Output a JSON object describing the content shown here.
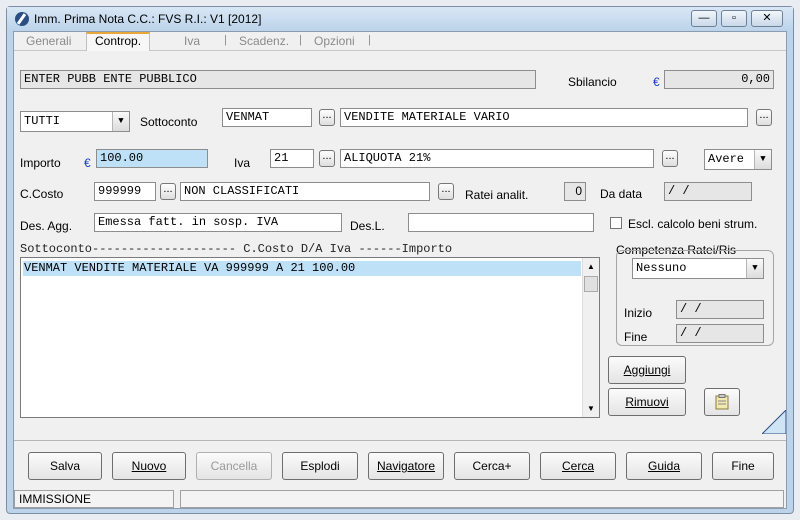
{
  "window": {
    "title": "Imm. Prima Nota C.C.: FVS  R.I.: V1  [2012]",
    "min": "—",
    "max": "▫",
    "close": "✕"
  },
  "tabs": [
    {
      "label": "Generali"
    },
    {
      "label": "Controp."
    },
    {
      "label": "Iva"
    },
    {
      "label": "Scadenz."
    },
    {
      "label": "Opzioni"
    }
  ],
  "tab_sep": "|",
  "header": {
    "description": "ENTER PUBB ENTE PUBBLICO",
    "sbilancio_label": "Sbilancio",
    "sbilancio_currency": "€",
    "sbilancio_value": "0,00"
  },
  "filter": {
    "value": "TUTTI"
  },
  "sottoconto": {
    "label": "Sottoconto",
    "code": "VENMAT",
    "description": "VENDITE MATERIALE VARIO"
  },
  "importo": {
    "label": "Importo",
    "currency": "€",
    "value": "100.00"
  },
  "iva": {
    "label": "Iva",
    "code": "21",
    "description": "ALIQUOTA 21%"
  },
  "dare_avere": {
    "value": "Avere"
  },
  "ccosto": {
    "label": "C.Costo",
    "code": "999999",
    "description": "NON CLASSIFICATI"
  },
  "ratei": {
    "label": "Ratei analit.",
    "value": "0"
  },
  "da_data": {
    "label": "Da data",
    "value": "  /  /"
  },
  "des_agg": {
    "label": "Des. Agg.",
    "value": "Emessa fatt. in sosp. IVA"
  },
  "des_l": {
    "label": "Des.L.",
    "value": ""
  },
  "escl": {
    "label": "Escl. calcolo beni strum."
  },
  "list": {
    "header": "Sottoconto-------------------- C.Costo D/A  Iva  ------Importo",
    "rows": [
      {
        "text": "VENMAT    VENDITE MATERIALE VA 999999   A  21          100.00"
      }
    ]
  },
  "competenza": {
    "label": "Competenza Ratei/Ris",
    "select": "Nessuno",
    "inizio_label": "Inizio",
    "inizio_value": "  /  /",
    "fine_label": "Fine",
    "fine_value": "  /  /"
  },
  "side_buttons": {
    "aggiungi": "Aggiungi",
    "rimuovi": "Rimuovi"
  },
  "dots": "...",
  "bottom_buttons": [
    {
      "label": "Salva"
    },
    {
      "label": "Nuovo"
    },
    {
      "label": "Cancella"
    },
    {
      "label": "Esplodi"
    },
    {
      "label": "Navigatore"
    },
    {
      "label": "Cerca+"
    },
    {
      "label": "Cerca"
    },
    {
      "label": "Guida"
    },
    {
      "label": "Fine"
    }
  ],
  "status": {
    "mode": "IMMISSIONE",
    "message": ""
  }
}
